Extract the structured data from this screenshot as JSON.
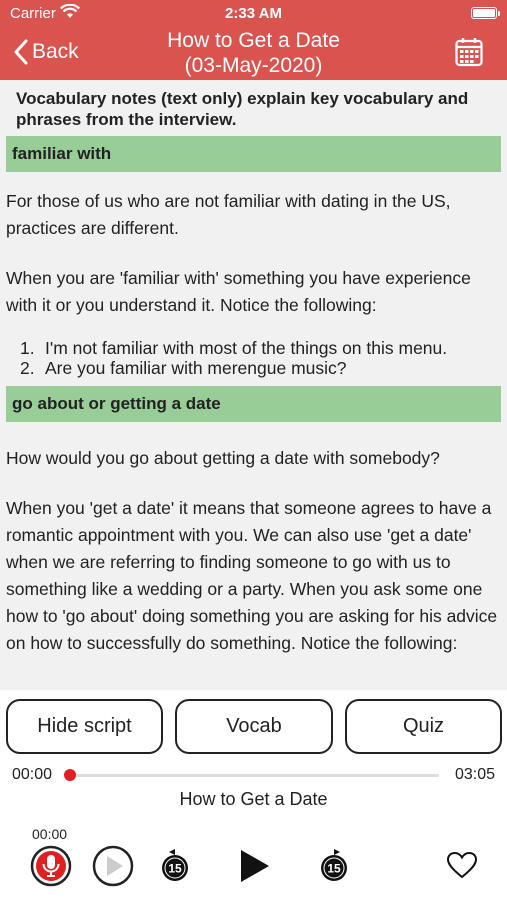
{
  "status_bar": {
    "carrier": "Carrier",
    "time": "2:33 AM"
  },
  "header": {
    "back_label": "Back",
    "title_line1": "How to Get a Date",
    "title_line2": "(03-May-2020)"
  },
  "content": {
    "intro": "Vocabulary notes (text only) explain key vocabulary and phrases from the interview.",
    "sections": [
      {
        "heading": "familiar with",
        "paragraphs": [
          "For those of us who are not familiar with dating in the US, practices are different.",
          "When you are 'familiar with' something you have experience with it or you understand it. Notice the following:"
        ],
        "list": [
          {
            "num": "1.",
            "text": "I'm not familiar with most of the things on this menu."
          },
          {
            "num": "2.",
            "text": "Are you familiar with merengue music?"
          }
        ]
      },
      {
        "heading": "go about or getting a date",
        "paragraphs": [
          "How would you go about getting a date with somebody?",
          "When you 'get a date' it means that someone agrees to have a romantic appointment with you. We can also use 'get a date' when we are referring to finding someone to go with us to something like a wedding or a party. When you ask some one how to 'go about' doing something you are asking for his advice on how to successfully do something. Notice the following:"
        ]
      }
    ]
  },
  "buttons": {
    "hide_script": "Hide script",
    "vocab": "Vocab",
    "quiz": "Quiz"
  },
  "player": {
    "current_time": "00:00",
    "duration": "03:05",
    "progress": 0,
    "track_title": "How to Get a Date",
    "record_time": "00:00",
    "skip_back_seconds": "15",
    "skip_forward_seconds": "15"
  },
  "colors": {
    "header_bg": "#d9534f",
    "section_head_bg": "#98cd98",
    "accent_red": "#e02020"
  },
  "icons": [
    "wifi-icon",
    "battery-icon",
    "chevron-left-icon",
    "calendar-icon",
    "microphone-icon",
    "play-circle-icon",
    "skip-back-15-icon",
    "play-icon",
    "skip-forward-15-icon",
    "heart-icon"
  ]
}
